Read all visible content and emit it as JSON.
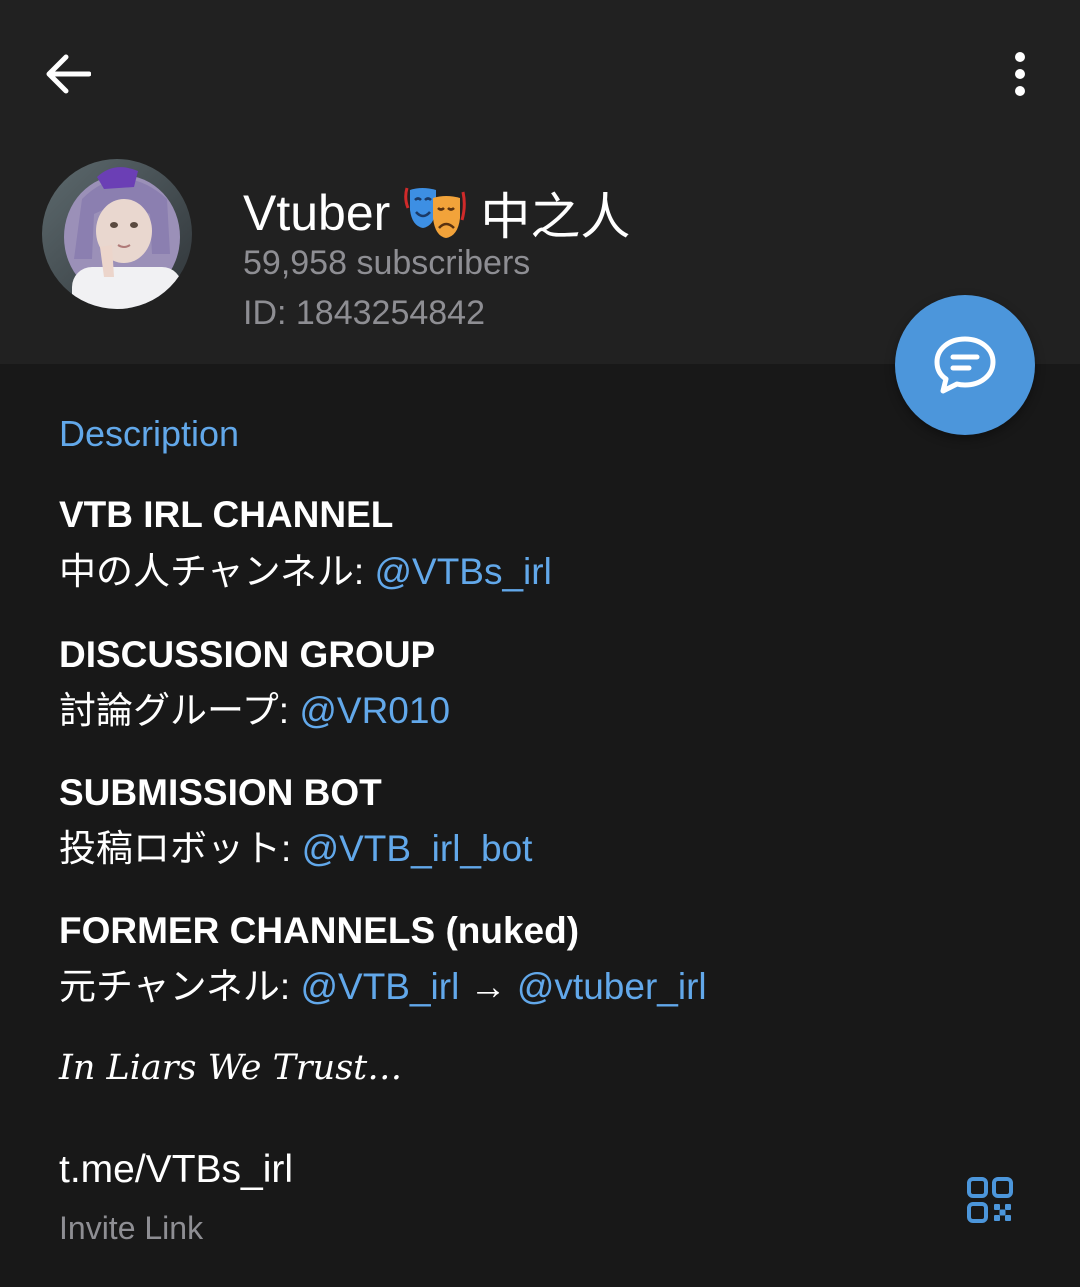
{
  "header": {
    "back_icon": "arrow-left-icon",
    "menu_icon": "more-vertical-icon",
    "channel_name_prefix": "Vtuber",
    "title_emoji_icon": "performing-arts-masks-icon",
    "channel_name_suffix": "中之人",
    "subscribers": "59,958 subscribers",
    "id_label": "ID: 1843254842",
    "fab_icon": "chat-bubble-icon",
    "accent_color": "#4c96db"
  },
  "description": {
    "label": "Description",
    "blocks": [
      {
        "heading": "VTB IRL CHANNEL",
        "line_prefix": "中の人チャンネル: ",
        "links": [
          "@VTBs_irl"
        ]
      },
      {
        "heading": "DISCUSSION GROUP",
        "line_prefix": "討論グループ: ",
        "links": [
          "@VR010"
        ]
      },
      {
        "heading": "SUBMISSION BOT",
        "line_prefix": "投稿ロボット: ",
        "links": [
          "@VTB_irl_bot"
        ]
      },
      {
        "heading": "FORMER CHANNELS",
        "heading_suffix": " (nuked)",
        "line_prefix": "元チャンネル: ",
        "links": [
          "@VTB_irl",
          "@vtuber_irl"
        ],
        "arrow": " → "
      }
    ],
    "motto": "In Liars We Trust…"
  },
  "invite": {
    "link": "t.me/VTBs_irl",
    "caption": "Invite Link",
    "qr_icon": "qr-code-icon"
  },
  "colors": {
    "background": "#181818",
    "header_background": "#212121",
    "link": "#62a8ea",
    "secondary_text": "#8e8e93"
  }
}
